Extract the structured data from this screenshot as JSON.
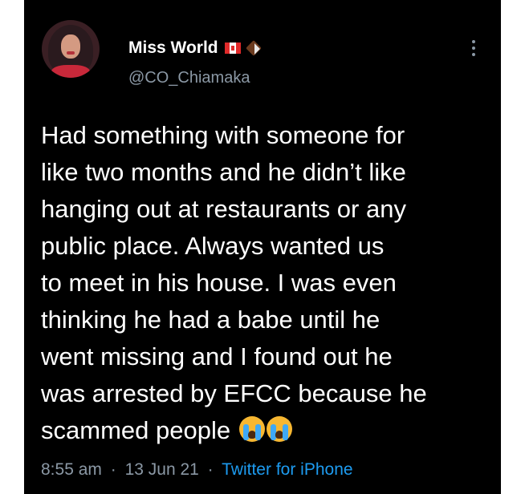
{
  "user": {
    "display_name": "Miss World",
    "handle": "@CO_Chiamaka",
    "badges": [
      "canada-flag-icon",
      "chocolate-bar-icon"
    ]
  },
  "tweet": {
    "lines": [
      "Had something with someone for",
      "like two months and he didn’t like",
      "hanging out at restaurants or any",
      "public place. Always wanted us",
      "to meet in his house. I was even",
      "thinking he had a babe until he",
      "went missing and I found out he",
      "was arrested by EFCC because he",
      "scammed people"
    ],
    "emojis": [
      "loudly-crying-face-icon",
      "loudly-crying-face-icon"
    ]
  },
  "meta": {
    "time": "8:55 am",
    "date": "13 Jun 21",
    "separator": "·",
    "source": "Twitter for iPhone"
  },
  "colors": {
    "background": "#000000",
    "text": "#ffffff",
    "secondary": "#8b98a5",
    "link": "#1d9bf0"
  }
}
